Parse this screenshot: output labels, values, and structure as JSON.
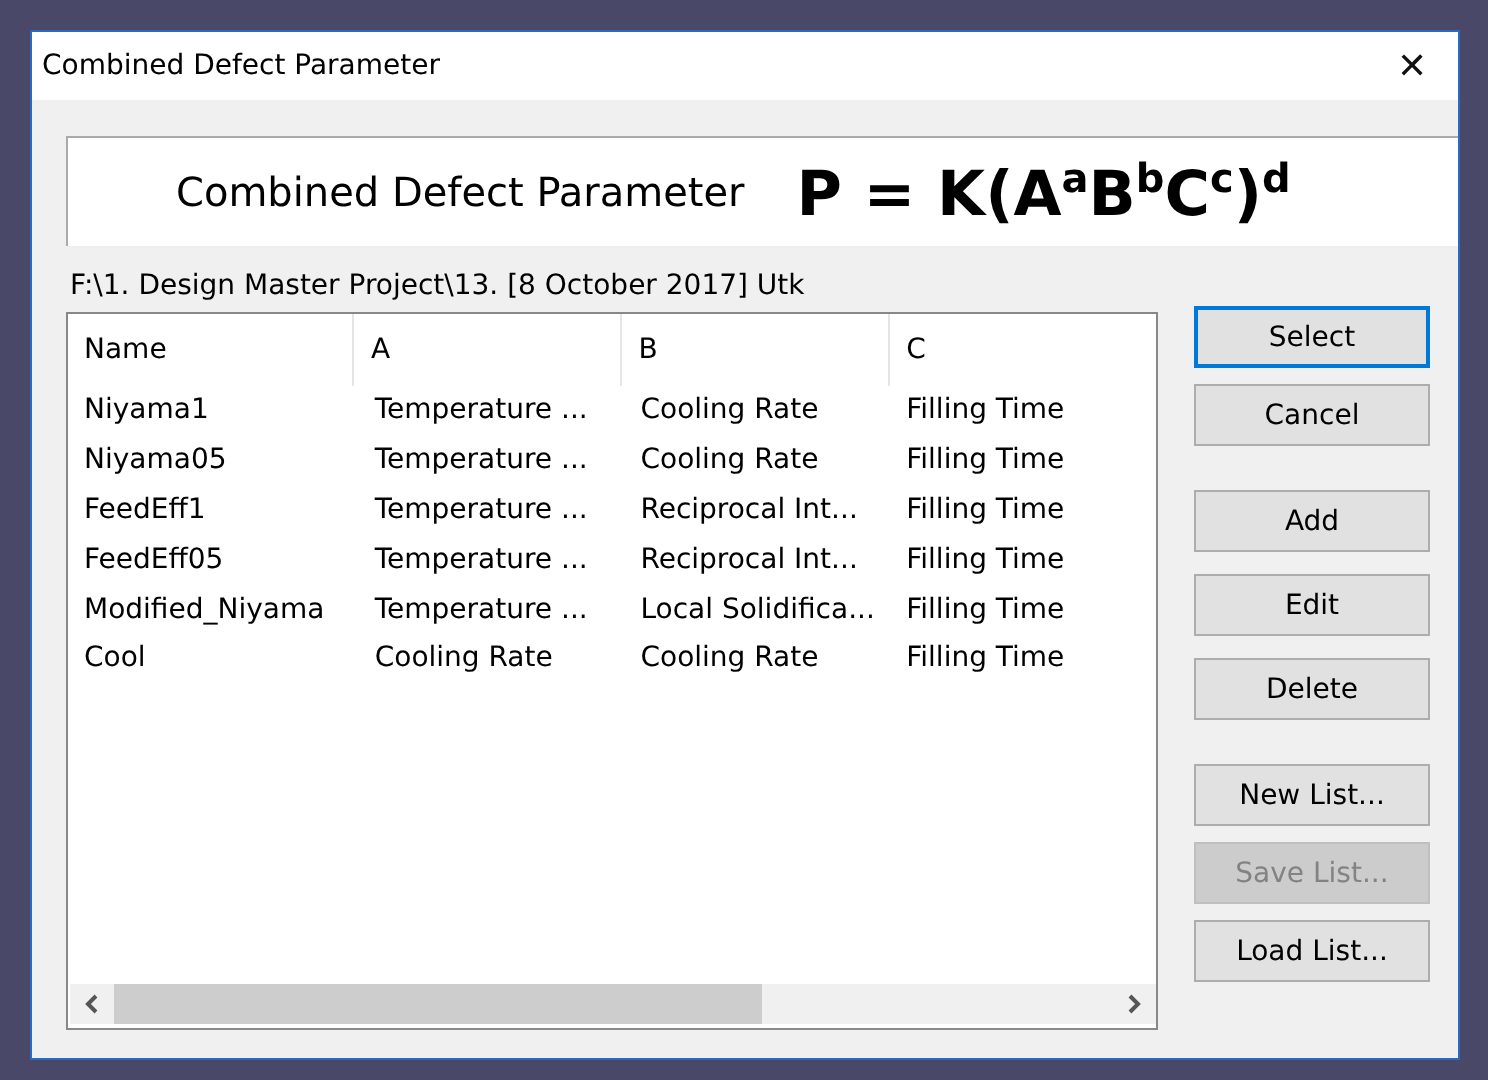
{
  "window": {
    "title": "Combined Defect Parameter",
    "close": "✕"
  },
  "banner": {
    "caption": "Combined Defect Parameter",
    "formula": "P = K(A$^{a}$B$^{b}$C$^{c}$)$^{d}$"
  },
  "path": "F:\\1. Design Master Project\\13. [8 October 2017] Utk",
  "table": {
    "columns": [
      "Name",
      "A",
      "B",
      "C"
    ],
    "rows": [
      [
        "Niyama1",
        "Temperature ...",
        "Cooling Rate",
        "Filling Time"
      ],
      [
        "Niyama05",
        "Temperature ...",
        "Cooling Rate",
        "Filling Time"
      ],
      [
        "FeedEff1",
        "Temperature ...",
        "Reciprocal Int...",
        "Filling Time"
      ],
      [
        "FeedEff05",
        "Temperature ...",
        "Reciprocal Int...",
        "Filling Time"
      ],
      [
        "Modified_Niyama",
        "Temperature ...",
        "Local Solidifica...",
        "Filling Time"
      ],
      [
        "Cool",
        "Cooling Rate",
        "Cooling Rate",
        "Filling Time"
      ]
    ]
  },
  "button_groups": [
    [
      {
        "label": "Select",
        "default": true,
        "disabled": false
      },
      {
        "label": "Cancel",
        "default": false,
        "disabled": false
      }
    ],
    [
      {
        "label": "Add",
        "default": false,
        "disabled": false
      },
      {
        "label": "Edit",
        "default": false,
        "disabled": false
      },
      {
        "label": "Delete",
        "default": false,
        "disabled": false
      }
    ],
    [
      {
        "label": "New List...",
        "default": false,
        "disabled": false
      },
      {
        "label": "Save List...",
        "default": false,
        "disabled": true
      },
      {
        "label": "Load List...",
        "default": false,
        "disabled": false
      }
    ]
  ]
}
